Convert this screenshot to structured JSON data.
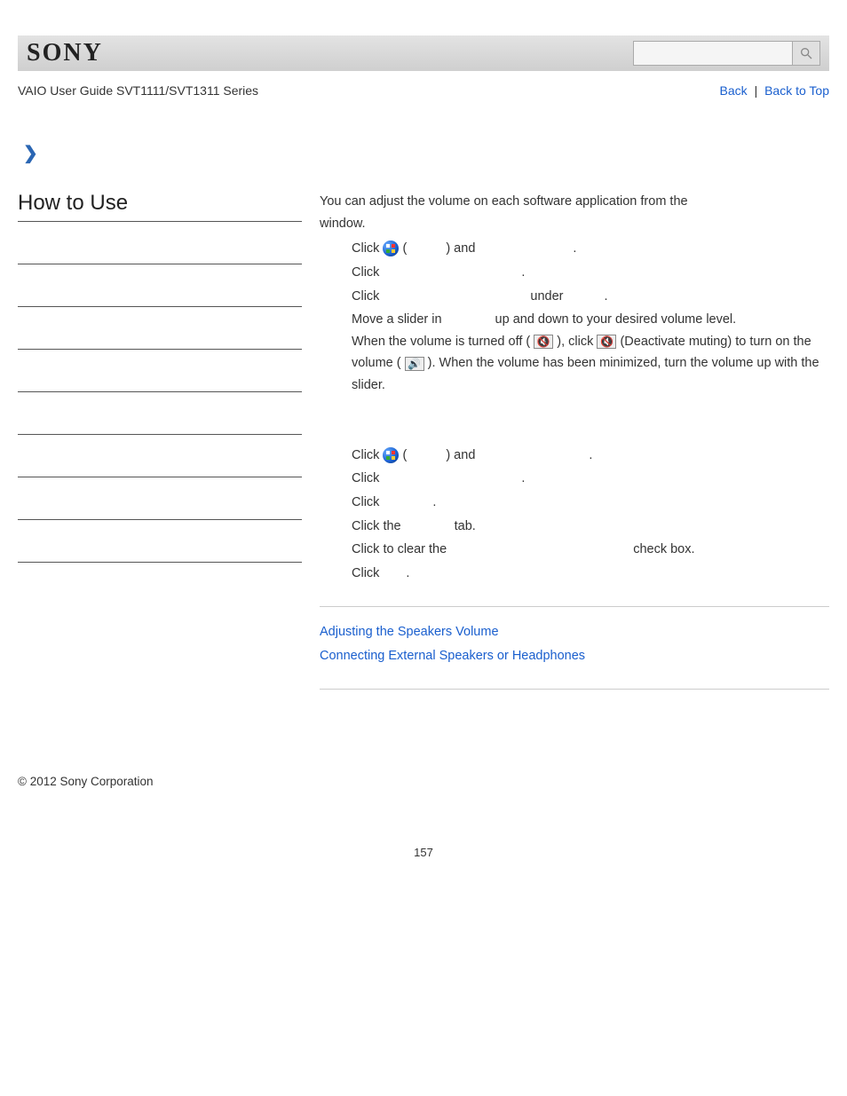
{
  "header": {
    "brand": "SONY",
    "guide_title": "VAIO User Guide SVT1111/SVT1311 Series",
    "search_placeholder": "",
    "nav": {
      "back": "Back",
      "top": "Back to Top",
      "sep": "|"
    }
  },
  "sidebar": {
    "title": "How to Use",
    "item_count": 8
  },
  "content": {
    "intro_prefix": "You can adjust the volume on each software application from the",
    "intro_suffix": "window.",
    "steps1": {
      "s1a": "Click ",
      "s1b": " (",
      "s1c": ") and",
      "s2a": "Click",
      "s2b": ".",
      "s3a": "Click",
      "s3b": "under",
      "s3c": ".",
      "s4a": "Move a slider in",
      "s4b": "up and down to your desired volume level.",
      "s4c": "When the volume is turned off (",
      "s4d": "), click",
      "s4e": "(Deactivate muting) to turn on the volume (",
      "s4f": "). When the volume has been minimized, turn the volume up with the slider."
    },
    "steps2": {
      "s1a": "Click ",
      "s1b": " (",
      "s1c": ") and",
      "s2a": "Click",
      "s2b": ".",
      "s3a": "Click",
      "s3b": ".",
      "s4a": "Click the",
      "s4b": "tab.",
      "s5a": "Click to clear the",
      "s5b": "check box.",
      "s6a": "Click",
      "s6b": "."
    },
    "related": {
      "link1": "Adjusting the Speakers Volume",
      "link2": "Connecting External Speakers or Headphones"
    }
  },
  "footer": {
    "copyright": "© 2012 Sony Corporation",
    "page_num": "157"
  }
}
